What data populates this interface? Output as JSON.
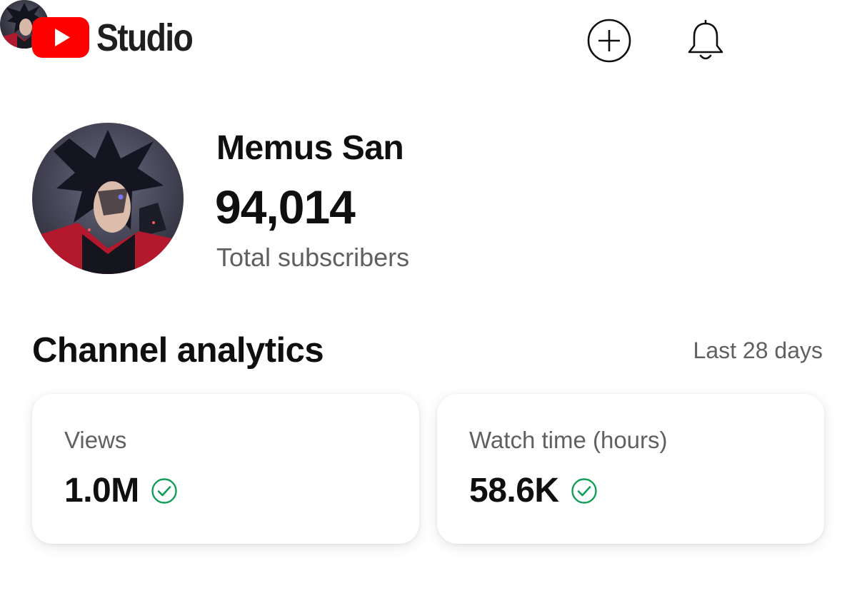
{
  "header": {
    "logo_text": "Studio",
    "create_icon": "create-plus-icon",
    "notifications_icon": "bell-icon",
    "brand_color": "#ff0000"
  },
  "profile": {
    "channel_name": "Memus San",
    "subscriber_count": "94,014",
    "subscriber_label": "Total subscribers"
  },
  "analytics": {
    "title": "Channel analytics",
    "range": "Last 28 days",
    "cards": [
      {
        "label": "Views",
        "value": "1.0M",
        "status_icon": "check-circle-icon"
      },
      {
        "label": "Watch time (hours)",
        "value": "58.6K",
        "status_icon": "check-circle-icon"
      }
    ],
    "status_color": "#0f9d58"
  }
}
